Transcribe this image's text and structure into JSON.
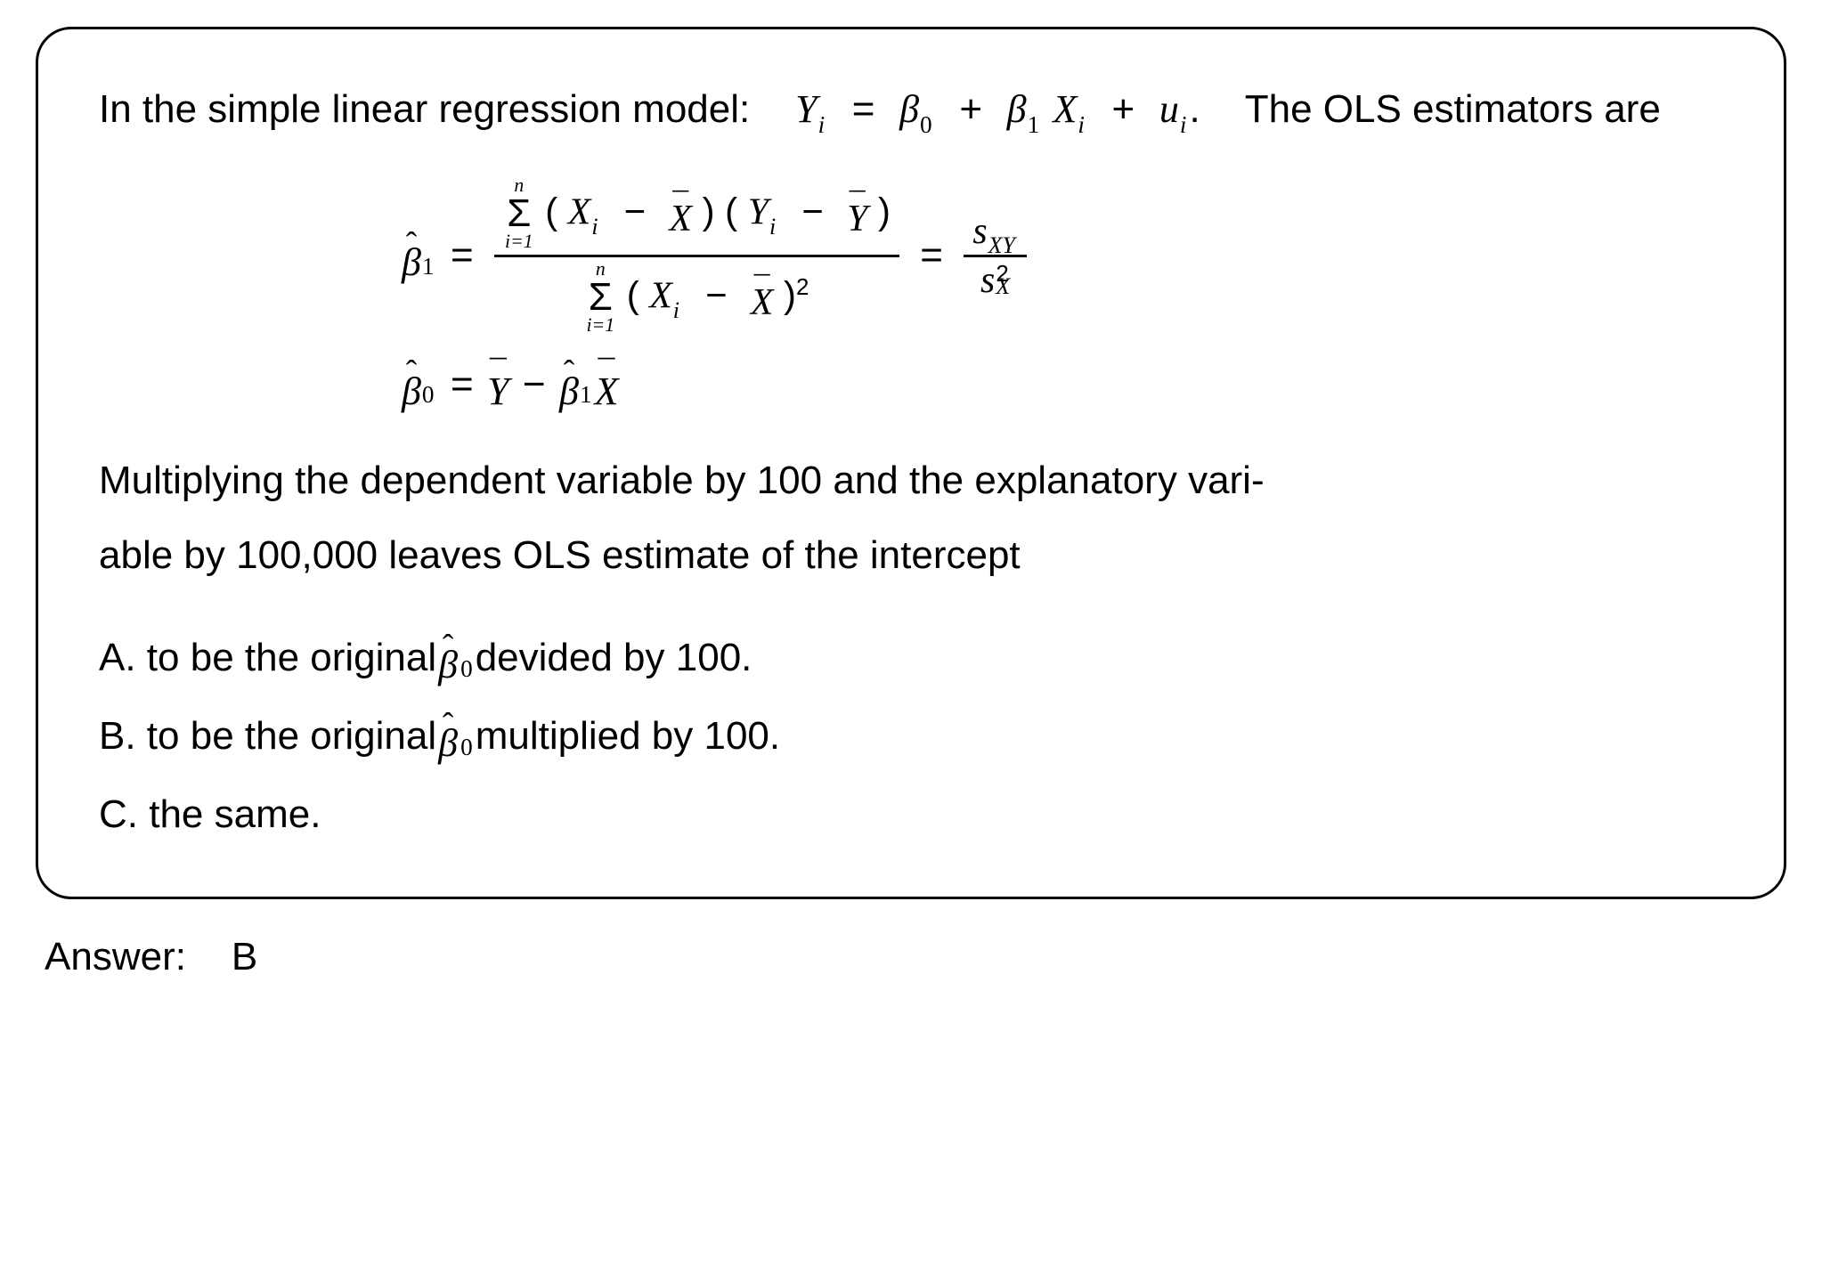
{
  "frame": {
    "intro_part1": "In the simple linear regression model:",
    "intro_model_inline_plain": "Yᵢ = β₀ + β₁Xᵢ + uᵢ.",
    "intro_part2": "The OLS estimators are",
    "beta1_formula_description": "β̂₁ = Σ(Xᵢ − X̄)(Yᵢ − Ȳ) / Σ(Xᵢ − X̄)² = s_XY / s_X²",
    "beta0_formula_description": "β̂₀ = Ȳ − β̂₁ X̄",
    "sum_lower": "i=1",
    "sum_upper": "n",
    "s_xy": "s",
    "s_xy_sub": "XY",
    "s_x": "s",
    "s_x_sup": "2",
    "s_x_sub": "X",
    "beta": "β",
    "Y": "Y",
    "X": "X",
    "u": "u",
    "i": "i",
    "zero": "0",
    "one": "1",
    "plus": "+",
    "minus": "−",
    "eq": "=",
    "dot": ".",
    "lp": "(",
    "rp": ")",
    "sq": "2",
    "Sigma": "Σ",
    "hat": "ˆ",
    "bar": "¯",
    "question_part1": "Multiplying the dependent variable by 100 and the explanatory vari-",
    "question_part2": "able by 100,000 leaves OLS estimate of the intercept"
  },
  "options": {
    "A_pre": "A. to be the original ",
    "A_post": " devided by 100.",
    "B_pre": "B. to be the original ",
    "B_post": " multiplied by 100.",
    "C": "C. the same."
  },
  "answer": {
    "label": "Answer:",
    "value": "B"
  }
}
